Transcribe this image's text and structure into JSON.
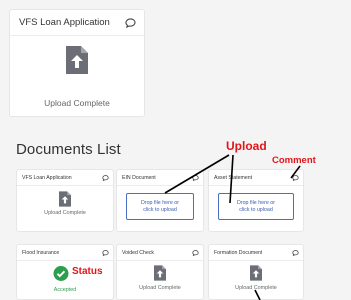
{
  "top_card": {
    "title": "VFS Loan Application",
    "status": "Upload Complete"
  },
  "section_title": "Documents List",
  "cards": [
    {
      "title": "VFS Loan Application",
      "status": "Upload Complete"
    },
    {
      "title": "EIN Document",
      "dropzone": "Drop file here or click to upload"
    },
    {
      "title": "Asset Statement",
      "dropzone": "Drop file here or click to upload"
    },
    {
      "title": "Flood Insurance",
      "status": "Accepted"
    },
    {
      "title": "Voided Check",
      "status": "Upload Complete"
    },
    {
      "title": "Formation Document",
      "status": "Upload Complete"
    }
  ],
  "annotations": {
    "upload": "Upload",
    "comment": "Comment",
    "status": "Status"
  },
  "colors": {
    "annotation": "#e0151b",
    "accepted": "#2e9e4e",
    "link": "#3a5db0",
    "icon": "#6b6f75"
  },
  "icons": [
    "comment-icon",
    "upload-file-icon",
    "check-circle-icon"
  ]
}
